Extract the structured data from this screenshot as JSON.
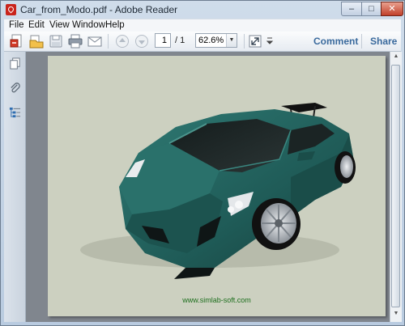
{
  "window": {
    "title": "Car_from_Modo.pdf - Adobe Reader",
    "controls": {
      "minimize": "–",
      "maximize": "□",
      "close": "✕"
    }
  },
  "menu": {
    "items": [
      {
        "label": "File"
      },
      {
        "label": "Edit"
      },
      {
        "label": "View"
      },
      {
        "label": "Window"
      },
      {
        "label": "Help"
      }
    ]
  },
  "toolbar": {
    "buttons": [
      {
        "icon": "create-pdf-icon"
      },
      {
        "icon": "open-icon"
      },
      {
        "icon": "save-icon"
      },
      {
        "icon": "print-icon"
      },
      {
        "icon": "email-icon"
      },
      {
        "icon": "previous-page-icon"
      },
      {
        "icon": "next-page-icon"
      },
      {
        "icon": "fit-page-icon"
      },
      {
        "icon": "toolbar-overflow-icon"
      }
    ],
    "page_number": "1",
    "page_total": "/ 1",
    "zoom": "62.6%",
    "comment_label": "Comment",
    "share_label": "Share"
  },
  "nav_pane": {
    "icons": [
      "pages-icon",
      "attachments-icon",
      "bookmarks-icon"
    ]
  },
  "document": {
    "watermark": "www.simlab-soft.com",
    "car_color": "#1f5b57",
    "page_color": "#ccd0c0"
  },
  "colors": {
    "accent": "#3a6a9d",
    "app_icon": "#c9241c",
    "workspace": "#80868e"
  }
}
